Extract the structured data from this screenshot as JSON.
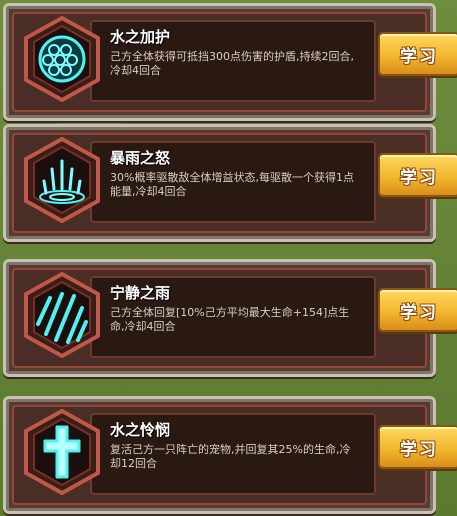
{
  "skills": [
    {
      "name": "水之加护",
      "description": "己方全体获得可抵挡300点伤害的护盾,持续2回合,冷却4回合",
      "icon": "shield-cells-icon",
      "button": "学习"
    },
    {
      "name": "暴雨之怒",
      "description": "30%概率驱散敌全体增益状态,每驱散一个获得1点能量,冷却4回合",
      "icon": "rain-splash-icon",
      "button": "学习"
    },
    {
      "name": "宁静之雨",
      "description": "己方全体回复[10%己方平均最大生命+154]点生命,冷却4回合",
      "icon": "rain-streaks-icon",
      "button": "学习"
    },
    {
      "name": "水之怜悯",
      "description": "复活己方一只阵亡的宠物,并回复其25%的生命,冷却12回合",
      "icon": "cross-icon",
      "button": "学习"
    }
  ],
  "colors": {
    "icon_glow": "#4ff2f0",
    "button_gold": "#f2b72f",
    "card_brown": "#5a3a30"
  }
}
